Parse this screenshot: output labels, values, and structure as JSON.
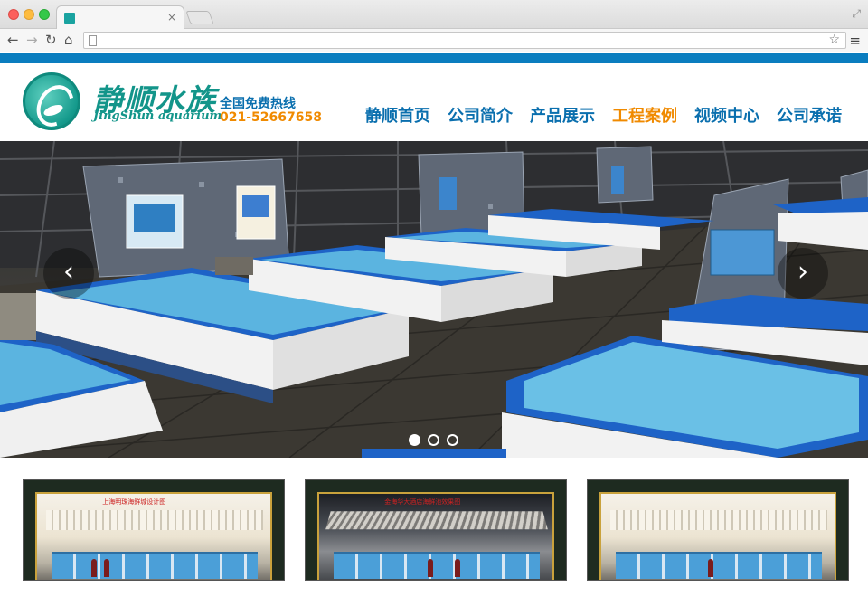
{
  "browser": {
    "tab_title": "",
    "address": "",
    "close_glyph": "×",
    "back_glyph": "←",
    "forward_glyph": "→",
    "reload_glyph": "↻",
    "home_glyph": "⌂",
    "star_glyph": "☆",
    "menu_glyph": "≡",
    "resize_glyph": "⤢"
  },
  "site": {
    "logo_cn": "静顺水族",
    "logo_en": "JingShun aquarium",
    "hotline_label": "全国免费热线",
    "hotline_number": "021-52667658",
    "brand_color": "#0a7dbf",
    "accent_color": "#f08a00",
    "nav": [
      {
        "label": "静顺首页",
        "active": false
      },
      {
        "label": "公司简介",
        "active": false
      },
      {
        "label": "产品展示",
        "active": false
      },
      {
        "label": "工程案例",
        "active": true
      },
      {
        "label": "视频中心",
        "active": false
      },
      {
        "label": "公司承诺",
        "active": false
      }
    ]
  },
  "banner": {
    "prev_glyph": "‹",
    "next_glyph": "›",
    "slide_count": 3,
    "active_slide": 1
  },
  "thumbnails": [
    {
      "caption": "上海明珠海鲜城设计图"
    },
    {
      "caption": "金海华大酒店海鲜池效果图"
    },
    {
      "caption": ""
    }
  ]
}
